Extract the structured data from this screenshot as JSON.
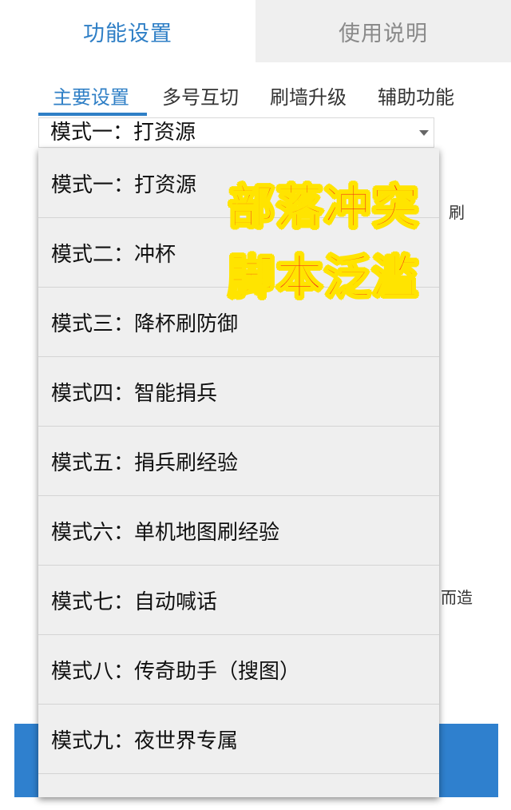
{
  "top_tabs": [
    {
      "label": "功能设置",
      "active": true
    },
    {
      "label": "使用说明",
      "active": false
    }
  ],
  "sub_tabs": [
    {
      "label": "主要设置",
      "active": true
    },
    {
      "label": "多号互切",
      "active": false
    },
    {
      "label": "刷墙升级",
      "active": false
    },
    {
      "label": "辅助功能",
      "active": false
    }
  ],
  "mode_select": {
    "value": "模式一：打资源",
    "options": [
      "模式一：打资源",
      "模式二：冲杯",
      "模式三：降杯刷防御",
      "模式四：智能捐兵",
      "模式五：捐兵刷经验",
      "模式六：单机地图刷经验",
      "模式七：自动喊话",
      "模式八：传奇助手（搜图）",
      "模式九：夜世界专属"
    ]
  },
  "background_fragments": {
    "fragment_1": "刷",
    "fragment_2": "而造"
  },
  "overlay": {
    "line1": "部落冲突",
    "line2": "脚本泛滥"
  },
  "colors": {
    "accent": "#2f7fc6",
    "bottom_bar": "#2f80ce",
    "overlay_fill": "#f2281a",
    "overlay_outline": "#ffe400"
  }
}
